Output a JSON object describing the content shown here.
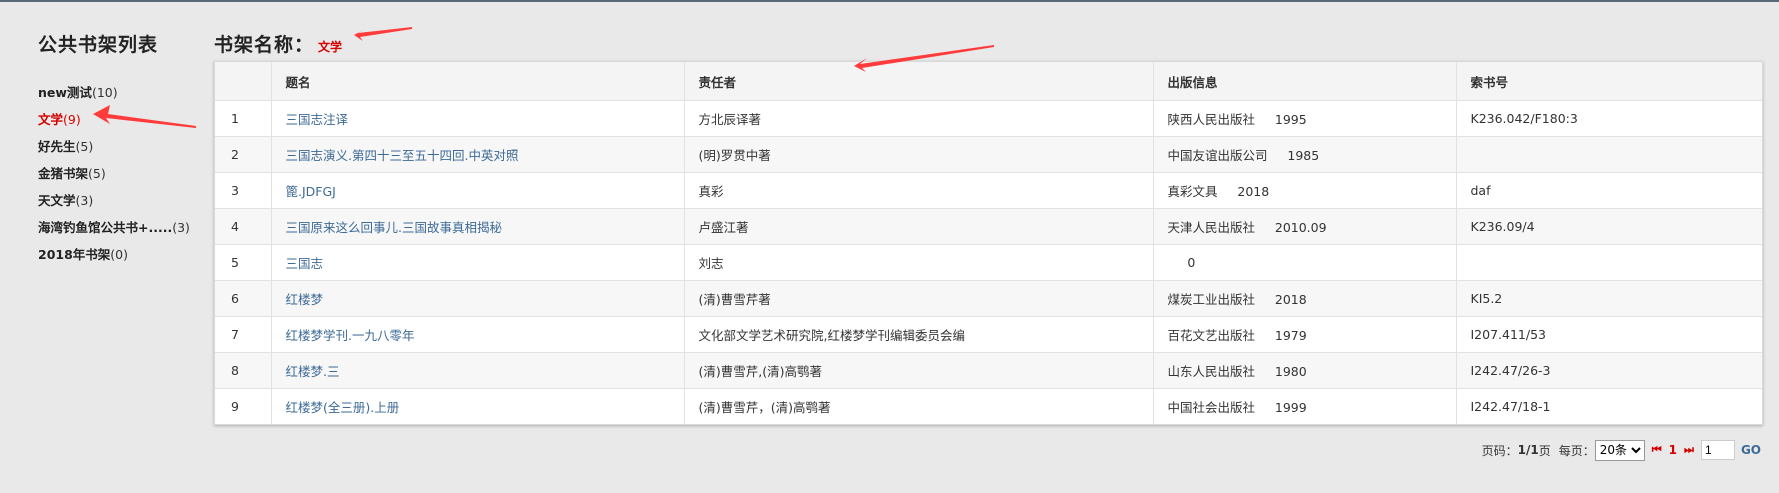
{
  "sidebar": {
    "title": "公共书架列表",
    "items": [
      {
        "name": "new测试",
        "count": "(10)"
      },
      {
        "name": "文学",
        "count": "(9)"
      },
      {
        "name": "好先生",
        "count": "(5)"
      },
      {
        "name": "金猪书架",
        "count": "(5)"
      },
      {
        "name": "天文学",
        "count": "(3)"
      },
      {
        "name": "海湾钓鱼馆公共书+.....",
        "count": "(3)"
      },
      {
        "name": "2018年书架",
        "count": "(0)"
      }
    ]
  },
  "shelf": {
    "label": "书架名称：",
    "value": "文学"
  },
  "table": {
    "headers": [
      "",
      "题名",
      "责任者",
      "出版信息",
      "索书号"
    ],
    "rows": [
      {
        "no": "1",
        "title": "三国志注译",
        "author": "方北辰译著",
        "pub": "陕西人民出版社     1995",
        "call": "K236.042/F180:3"
      },
      {
        "no": "2",
        "title": "三国志演义.第四十三至五十四回.中英对照",
        "author": "(明)罗贯中著",
        "pub": "中国友谊出版公司     1985",
        "call": ""
      },
      {
        "no": "3",
        "title": "篦.JDFGJ",
        "author": "真彩",
        "pub": "真彩文具     2018",
        "call": "daf"
      },
      {
        "no": "4",
        "title": "三国原来这么回事儿.三国故事真相揭秘",
        "author": "卢盛江著",
        "pub": "天津人民出版社     2010.09",
        "call": "K236.09/4"
      },
      {
        "no": "5",
        "title": "三国志",
        "author": "刘志",
        "pub": "     0",
        "call": ""
      },
      {
        "no": "6",
        "title": "红楼梦",
        "author": "(清)曹雪芹著",
        "pub": "煤炭工业出版社     2018",
        "call": "KI5.2"
      },
      {
        "no": "7",
        "title": "红楼梦学刊.一九八零年",
        "author": "文化部文学艺术研究院,红楼梦学刊编辑委员会编",
        "pub": "百花文艺出版社     1979",
        "call": "I207.411/53"
      },
      {
        "no": "8",
        "title": "红楼梦.三",
        "author": "(清)曹雪芹,(清)高鹗著",
        "pub": "山东人民出版社     1980",
        "call": "I242.47/26-3"
      },
      {
        "no": "9",
        "title": "红楼梦(全三册).上册",
        "author": "(清)曹雪芹，(清)高鹗著",
        "pub": "中国社会出版社     1999",
        "call": "I242.47/18-1"
      }
    ]
  },
  "pager": {
    "page_label": "页码：",
    "page_value": "1/1",
    "page_suffix": "页",
    "per_page_label": "每页：",
    "per_page_value": "20条",
    "first_icon": "⏮",
    "current_page": "1",
    "last_icon": "⏭",
    "jump_value": "1",
    "go_label": "GO"
  },
  "colors": {
    "accent_red": "#d40000",
    "link_blue": "#3d6a96",
    "annotation_arrow": "#ff3b3b"
  }
}
